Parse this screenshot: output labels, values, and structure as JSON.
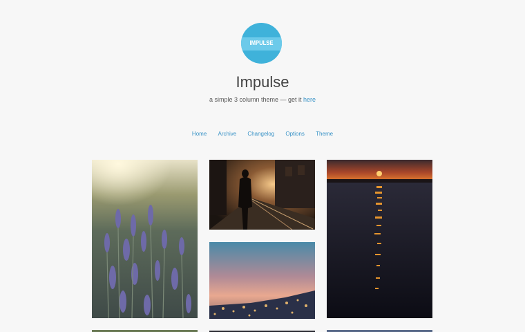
{
  "header": {
    "logo_text": "IMPULSE",
    "title": "Impulse",
    "tagline_prefix": "a simple 3 column theme — get it ",
    "tagline_link": "here"
  },
  "nav": {
    "items": [
      "Home",
      "Archive",
      "Changelog",
      "Options",
      "Theme"
    ]
  },
  "colors": {
    "accent": "#3fb2da",
    "link": "#3a93c7",
    "background": "#f7f7f7"
  },
  "gallery": {
    "photos": [
      "lavender-photo",
      "street-silhouette-photo",
      "sunset-water-photo",
      "dusk-city-lights-photo"
    ]
  }
}
